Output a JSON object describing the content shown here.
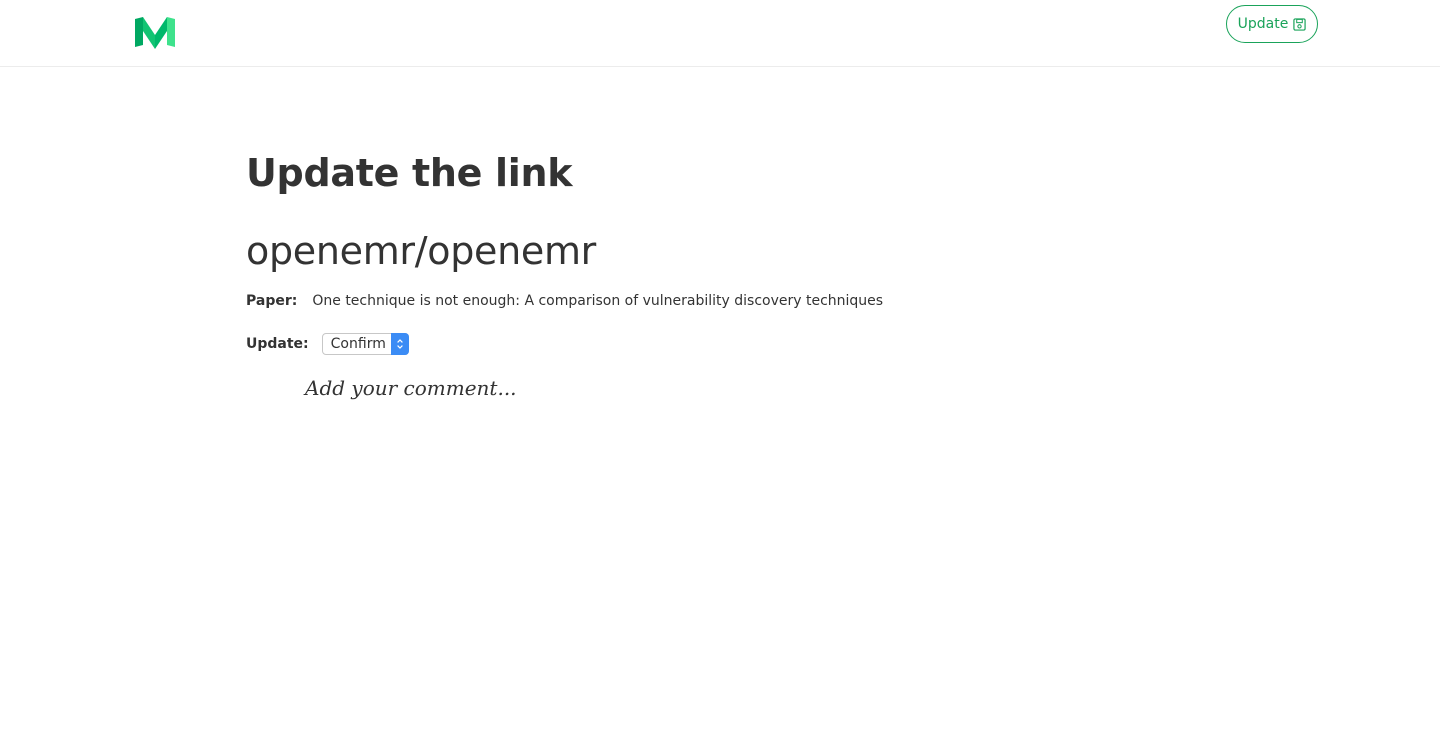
{
  "header": {
    "logo_name": "medium-logo",
    "update_button_label": "Update",
    "accent_color": "#1aa35a"
  },
  "main": {
    "title": "Update the link",
    "repo": "openemr/openemr",
    "paper_label": "Paper:",
    "paper_value": "One technique is not enough: A comparison of vulnerability discovery techniques",
    "update_label": "Update:",
    "update_select_value": "Confirm",
    "comment_placeholder": "Add your comment..."
  }
}
